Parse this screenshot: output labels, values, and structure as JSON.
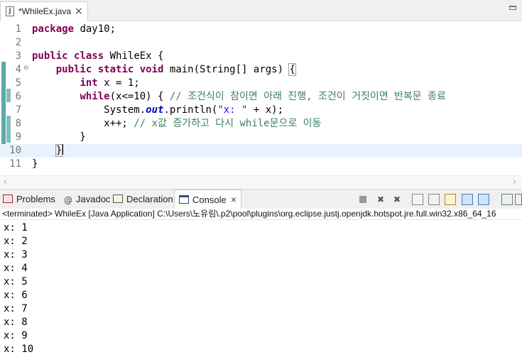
{
  "editor_tab": {
    "title": "*WhileEx.java",
    "close": "×"
  },
  "editor": {
    "lines": [
      {
        "num": "1",
        "segments": [
          {
            "t": "package",
            "c": "kw"
          },
          {
            "t": " day10;",
            "c": ""
          }
        ]
      },
      {
        "num": "2",
        "segments": []
      },
      {
        "num": "3",
        "segments": [
          {
            "t": "public",
            "c": "kw"
          },
          {
            "t": " ",
            "c": ""
          },
          {
            "t": "class",
            "c": "kw"
          },
          {
            "t": " WhileEx {",
            "c": ""
          }
        ]
      },
      {
        "num": "4",
        "fold": "⊖",
        "segments": [
          {
            "t": "    ",
            "c": ""
          },
          {
            "t": "public",
            "c": "kw"
          },
          {
            "t": " ",
            "c": ""
          },
          {
            "t": "static",
            "c": "kw"
          },
          {
            "t": " ",
            "c": ""
          },
          {
            "t": "void",
            "c": "kw"
          },
          {
            "t": " main(String[] args) ",
            "c": ""
          },
          {
            "t": "{",
            "c": "brace"
          }
        ]
      },
      {
        "num": "5",
        "segments": [
          {
            "t": "        ",
            "c": ""
          },
          {
            "t": "int",
            "c": "kw"
          },
          {
            "t": " x = 1;",
            "c": ""
          }
        ]
      },
      {
        "num": "6",
        "segments": [
          {
            "t": "        ",
            "c": ""
          },
          {
            "t": "while",
            "c": "kw"
          },
          {
            "t": "(x<=10) { ",
            "c": ""
          },
          {
            "t": "// 조건식이 참이면 아래 진행, 조건이 거짓이면 반복문 종료",
            "c": "cm"
          }
        ]
      },
      {
        "num": "7",
        "segments": [
          {
            "t": "            System.",
            "c": ""
          },
          {
            "t": "out",
            "c": "fld"
          },
          {
            "t": ".println(",
            "c": ""
          },
          {
            "t": "\"x: \"",
            "c": "st"
          },
          {
            "t": " + x);",
            "c": ""
          }
        ]
      },
      {
        "num": "8",
        "segments": [
          {
            "t": "            x++; ",
            "c": ""
          },
          {
            "t": "// x값 증가하고 다시 while문으로 이동",
            "c": "cm"
          }
        ]
      },
      {
        "num": "9",
        "segments": [
          {
            "t": "        }",
            "c": ""
          }
        ]
      },
      {
        "num": "10",
        "current": true,
        "segments": [
          {
            "t": "    ",
            "c": ""
          },
          {
            "t": "}",
            "c": "brace"
          },
          {
            "t": "",
            "c": "caret"
          }
        ]
      },
      {
        "num": "11",
        "segments": [
          {
            "t": "}",
            "c": ""
          }
        ]
      }
    ]
  },
  "views": {
    "tabs": [
      {
        "label": "Problems",
        "icon": "problems-icon",
        "active": false
      },
      {
        "label": "Javadoc",
        "icon": "javadoc-icon",
        "active": false
      },
      {
        "label": "Declaration",
        "icon": "declaration-icon",
        "active": false
      },
      {
        "label": "Console",
        "icon": "console-icon",
        "active": true,
        "close": "×"
      }
    ]
  },
  "console": {
    "status": "<terminated> WhileEx [Java Application] C:\\Users\\노유림\\.p2\\pool\\plugins\\org.eclipse.justj.openjdk.hotspot.jre.full.win32.x86_64_16",
    "output": [
      "x: 1",
      "x: 2",
      "x: 3",
      "x: 4",
      "x: 5",
      "x: 6",
      "x: 7",
      "x: 8",
      "x: 9",
      "x: 10"
    ]
  },
  "colors": {
    "keyword": "#7f0055",
    "comment": "#3f7f5f",
    "string": "#2a00ff",
    "field": "#0000c0",
    "current_line": "#e8f2fe"
  }
}
